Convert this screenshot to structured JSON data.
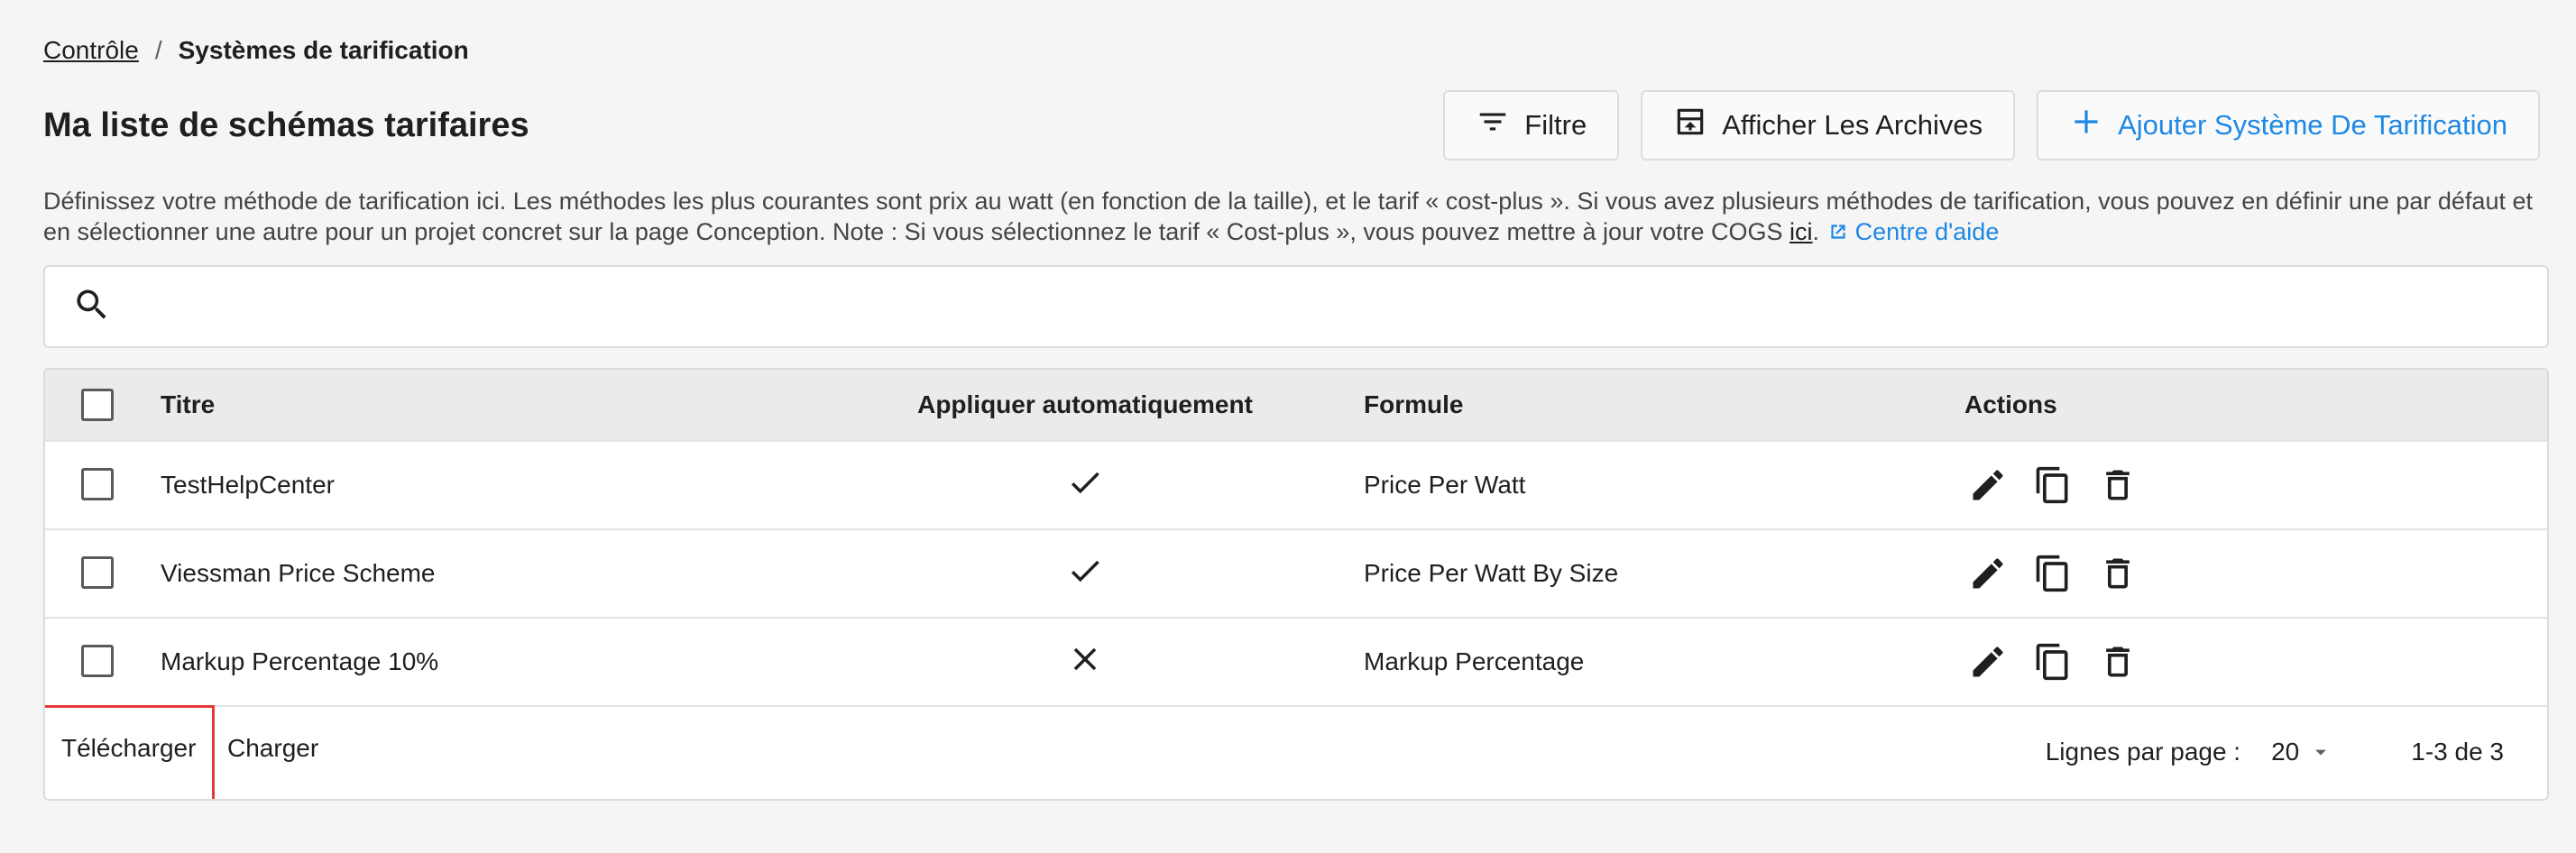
{
  "breadcrumb": {
    "parent": "Contrôle",
    "separator": "/",
    "current": "Systèmes de tarification"
  },
  "page": {
    "title": "Ma liste de schémas tarifaires"
  },
  "toolbar": {
    "filter_label": "Filtre",
    "archives_label": "Afficher Les Archives",
    "add_label": "Ajouter Système De Tarification"
  },
  "description": {
    "text": "Définissez votre méthode de tarification ici. Les méthodes les plus courantes sont prix au watt (en fonction de la taille), et le tarif « cost-plus ». Si vous avez plusieurs méthodes de tarification, vous pouvez en définir une par défaut et en sélectionner une autre pour un projet concret sur la page Conception. Note : Si vous sélectionnez le tarif « Cost-plus », vous pouvez mettre à jour votre COGS ",
    "link_text": "ici",
    "after_link": ".",
    "help_link": "Centre d'aide"
  },
  "search": {
    "value": "",
    "placeholder": ""
  },
  "table": {
    "headers": {
      "title": "Titre",
      "auto_apply": "Appliquer automatiquement",
      "formula": "Formule",
      "actions": "Actions"
    },
    "rows": [
      {
        "title": "TestHelpCenter",
        "auto_apply": "check-icon",
        "formula": "Price Per Watt"
      },
      {
        "title": "Viessman Price Scheme",
        "auto_apply": "check-icon",
        "formula": "Price Per Watt By Size"
      },
      {
        "title": "Markup Percentage 10%",
        "auto_apply": "close-icon",
        "formula": "Markup Percentage"
      }
    ]
  },
  "footer": {
    "download_label": "Télécharger",
    "upload_label": "Charger",
    "rows_per_page_label": "Lignes par page :",
    "rows_per_page_value": "20",
    "range_text": "1-3 de 3"
  },
  "colors": {
    "accent": "#1e88e5",
    "highlight": "#e53935",
    "header_bg": "#ebebeb",
    "page_bg": "#f5f5f5"
  }
}
